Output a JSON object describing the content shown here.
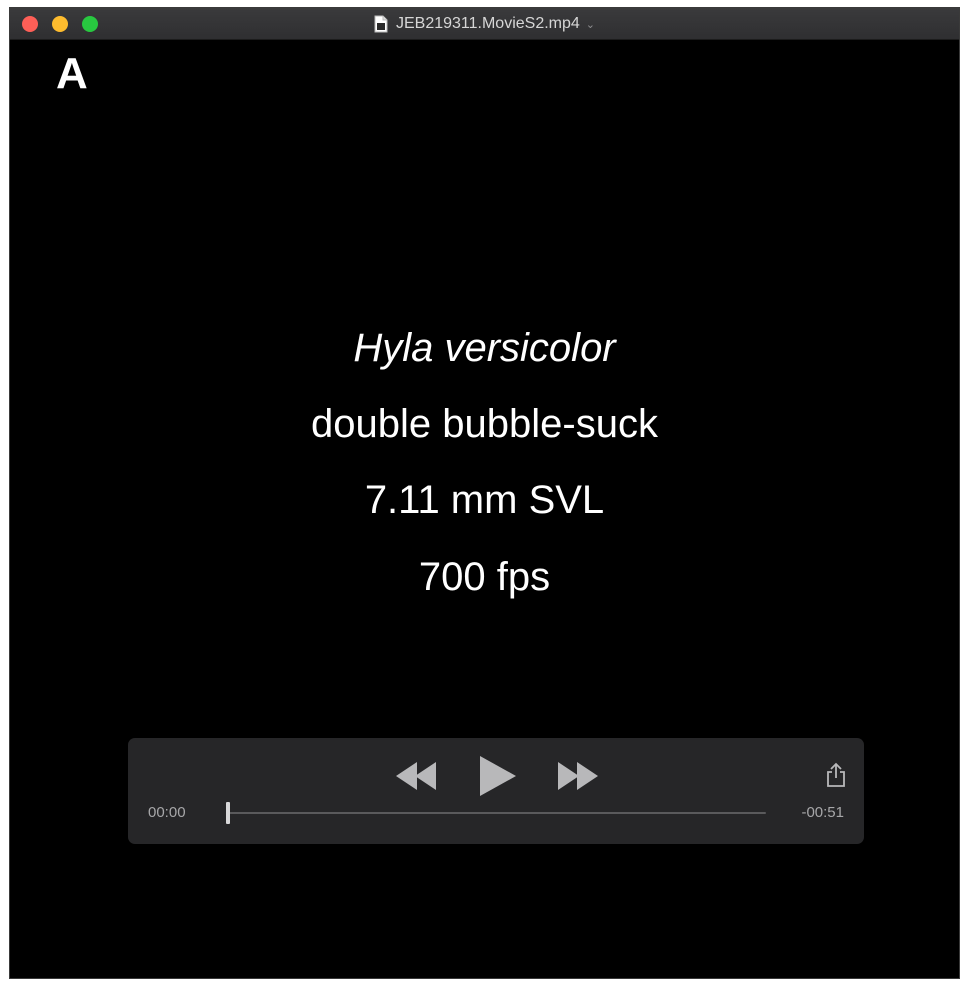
{
  "window": {
    "title": "JEB219311.MovieS2.mp4",
    "icons": {
      "close": "close-icon",
      "minimize": "minimize-icon",
      "maximize": "maximize-icon",
      "document": "document-icon",
      "title_menu": "chevron-down-icon"
    },
    "colors": {
      "close": "#fe5f57",
      "minimize": "#febc2e",
      "maximize": "#28c840"
    }
  },
  "video": {
    "panel_label": "A",
    "lines": [
      "Hyla versicolor",
      "double bubble-suck",
      "7.11 mm SVL",
      "700 fps"
    ]
  },
  "controls": {
    "current_time": "00:00",
    "remaining_time": "-00:51",
    "progress_fraction": 0.0,
    "icons": {
      "rewind": "rewind-icon",
      "play": "play-icon",
      "fast_forward": "fast-forward-icon",
      "share": "share-icon"
    }
  }
}
